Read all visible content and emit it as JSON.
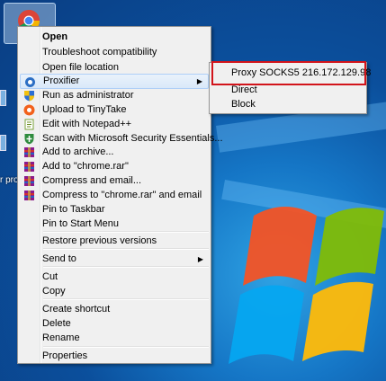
{
  "desktop": {
    "left_text_fragment": "r pro",
    "chrome_icon": "chrome-icon"
  },
  "context_menu": {
    "items": [
      {
        "label": "Open",
        "bold": true,
        "icon": ""
      },
      {
        "label": "Troubleshoot compatibility",
        "icon": ""
      },
      {
        "label": "Open file location",
        "icon": ""
      },
      {
        "label": "Proxifier",
        "icon": "proxifier-icon",
        "submenu": true,
        "highlighted": true
      },
      {
        "label": "Run as administrator",
        "icon": "shield-icon"
      },
      {
        "label": "Upload to TinyTake",
        "icon": "tinytake-icon"
      },
      {
        "label": "Edit with Notepad++",
        "icon": "notepad-icon"
      },
      {
        "label": "Scan with Microsoft Security Essentials...",
        "icon": "security-essentials-icon"
      },
      {
        "label": "Add to archive...",
        "icon": "winrar-icon"
      },
      {
        "label": "Add to \"chrome.rar\"",
        "icon": "winrar-icon"
      },
      {
        "label": "Compress and email...",
        "icon": "winrar-icon"
      },
      {
        "label": "Compress to \"chrome.rar\" and email",
        "icon": "winrar-icon"
      },
      {
        "label": "Pin to Taskbar",
        "icon": ""
      },
      {
        "label": "Pin to Start Menu",
        "icon": ""
      },
      {
        "label": "Restore previous versions",
        "icon": ""
      },
      {
        "label": "Send to",
        "icon": "",
        "submenu": true
      },
      {
        "label": "Cut",
        "icon": ""
      },
      {
        "label": "Copy",
        "icon": ""
      },
      {
        "label": "Create shortcut",
        "icon": ""
      },
      {
        "label": "Delete",
        "icon": ""
      },
      {
        "label": "Rename",
        "icon": ""
      },
      {
        "label": "Properties",
        "icon": ""
      }
    ]
  },
  "proxifier_submenu": {
    "items": [
      {
        "label": "Proxy SOCKS5 216.172.129.98",
        "highlighted": true
      },
      {
        "label": "Direct"
      },
      {
        "label": "Block"
      }
    ]
  },
  "colors": {
    "highlight_border": "#d2141b",
    "menu_bg": "#f0f0f0",
    "desktop_blue": "#0b4f9c"
  }
}
